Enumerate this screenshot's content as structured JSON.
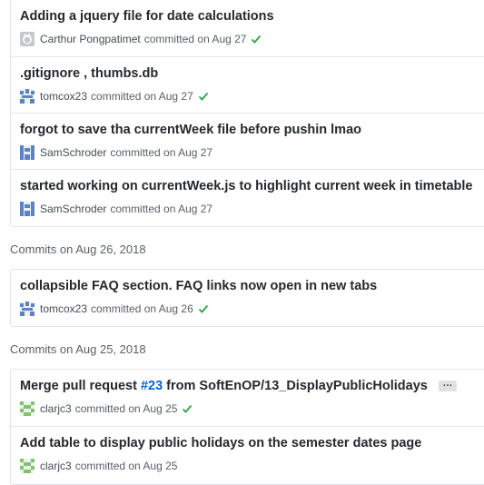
{
  "groups": [
    {
      "header": null,
      "commits": [
        {
          "message": "Adding a jquery file for date calculations",
          "author": "Carthur Pongpatimet",
          "committed_text": "committed on Aug 27",
          "verified": true,
          "avatar": "octocat-avatar-icon"
        },
        {
          "message": ".gitignore , thumbs.db",
          "author": "tomcox23",
          "committed_text": "committed on Aug 27",
          "verified": true,
          "avatar": "identicon-blue-icon"
        },
        {
          "message": "forgot to save tha currentWeek file before pushin lmao",
          "author": "SamSchroder",
          "committed_text": "committed on Aug 27",
          "verified": false,
          "avatar": "identicon-blue2-icon"
        },
        {
          "message": "started working on currentWeek.js to highlight current week in timetable",
          "author": "SamSchroder",
          "committed_text": "committed on Aug 27",
          "verified": false,
          "avatar": "identicon-blue2-icon"
        }
      ]
    },
    {
      "header": "Commits on Aug 26, 2018",
      "commits": [
        {
          "message": "collapsible FAQ section. FAQ links now open in new tabs",
          "author": "tomcox23",
          "committed_text": "committed on Aug 26",
          "verified": true,
          "avatar": "identicon-blue-icon"
        }
      ]
    },
    {
      "header": "Commits on Aug 25, 2018",
      "commits": [
        {
          "message_prefix": "Merge pull request ",
          "message_link": "#23",
          "message_suffix": " from SoftEnOP/13_DisplayPublicHolidays",
          "author": "clarjc3",
          "committed_text": "committed on Aug 25",
          "verified": true,
          "avatar": "identicon-green-icon",
          "ellipsis_label": "…"
        },
        {
          "message": "Add table to display public holidays on the semester dates page",
          "author": "clarjc3",
          "committed_text": "committed on Aug 25",
          "verified": false,
          "avatar": "identicon-green-icon"
        }
      ]
    }
  ],
  "colors": {
    "check": "#28a745",
    "link": "#0366d6",
    "identicon_blue": "#5a84c8",
    "identicon_green": "#7ec46c"
  }
}
